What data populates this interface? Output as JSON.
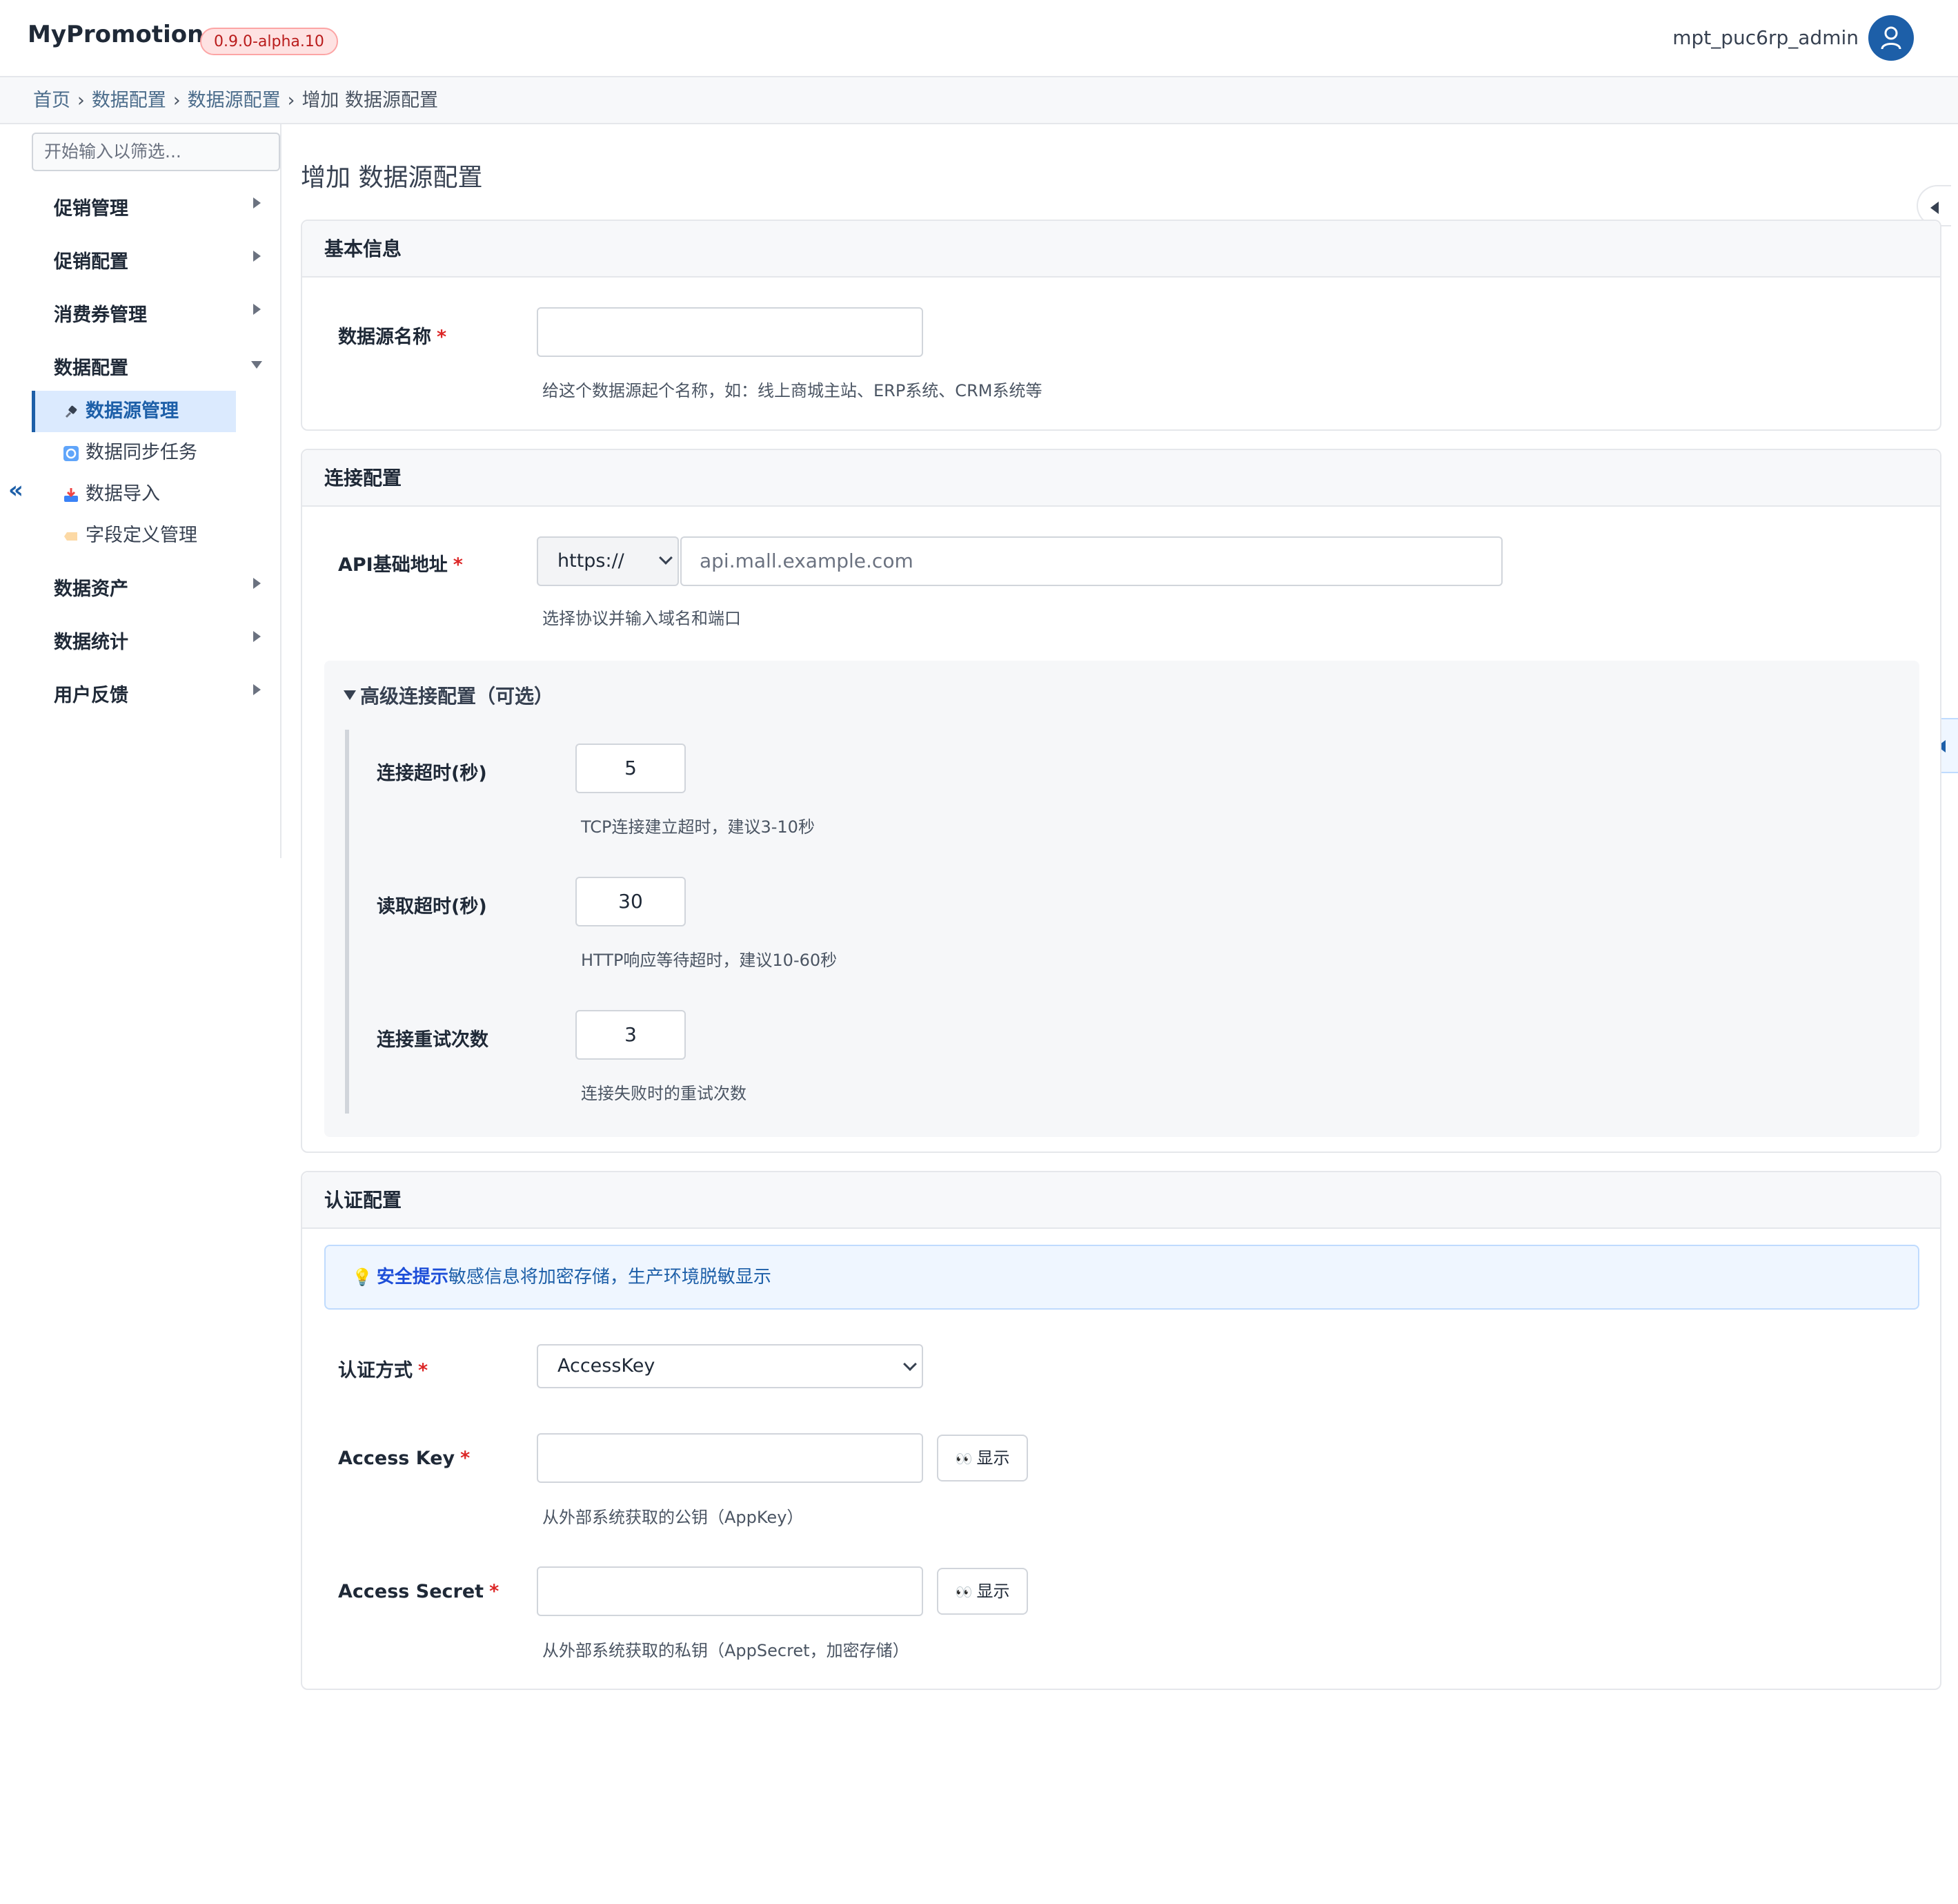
{
  "header": {
    "brand": "MyPromotion",
    "version": "0.9.0-alpha.10",
    "username": "mpt_puc6rp_admin",
    "avatar_icon": "user-icon"
  },
  "breadcrumb": {
    "items": [
      "首页",
      "数据配置",
      "数据源配置"
    ],
    "current": "增加 数据源配置",
    "separator": "›"
  },
  "sidebar": {
    "filter_placeholder": "开始输入以筛选...",
    "groups": [
      {
        "label": "促销管理",
        "expanded": false
      },
      {
        "label": "促销配置",
        "expanded": false
      },
      {
        "label": "消费券管理",
        "expanded": false
      },
      {
        "label": "数据配置",
        "expanded": true
      },
      {
        "label": "数据资产",
        "expanded": false
      },
      {
        "label": "数据统计",
        "expanded": false
      },
      {
        "label": "用户反馈",
        "expanded": false
      }
    ],
    "subitems": [
      {
        "label": "数据源管理",
        "icon": "plug-icon",
        "active": true
      },
      {
        "label": "数据同步任务",
        "icon": "sync-icon",
        "active": false
      },
      {
        "label": "数据导入",
        "icon": "inbox-tray-icon",
        "active": false
      },
      {
        "label": "字段定义管理",
        "icon": "label-tag-icon",
        "active": false
      }
    ],
    "collapse_label": "«"
  },
  "main": {
    "title": "增加 数据源配置",
    "basic": {
      "heading": "基本信息",
      "name_label": "数据源名称",
      "required_mark": "*",
      "name_value": "",
      "name_help": "给这个数据源起个名称，如：线上商城主站、ERP系统、CRM系统等"
    },
    "connection": {
      "heading": "连接配置",
      "api_label": "API基础地址",
      "protocol_value": "https://",
      "host_placeholder": "api.mall.example.com",
      "api_help": "选择协议并输入域名和端口",
      "advanced_title": "高级连接配置（可选）",
      "connect_timeout_label": "连接超时(秒)",
      "connect_timeout_value": "5",
      "connect_timeout_help": "TCP连接建立超时，建议3-10秒",
      "read_timeout_label": "读取超时(秒)",
      "read_timeout_value": "30",
      "read_timeout_help": "HTTP响应等待超时，建议10-60秒",
      "retries_label": "连接重试次数",
      "retries_value": "3",
      "retries_help": "连接失败时的重试次数"
    },
    "auth": {
      "heading": "认证配置",
      "alert_strong": "安全提示",
      "alert_text": "敏感信息将加密存储，生产环境脱敏显示",
      "method_label": "认证方式",
      "method_value": "AccessKey",
      "access_key_label": "Access Key",
      "access_key_value": "",
      "access_key_help": "从外部系统获取的公钥（AppKey）",
      "access_secret_label": "Access Secret",
      "access_secret_value": "",
      "access_secret_help": "从外部系统获取的私钥（AppSecret，加密存储）",
      "show_button": "显示",
      "show_icon": "eyes-icon"
    }
  },
  "colors": {
    "accent": "#1d5fa8",
    "required": "#dc2626",
    "badge_text": "#b91c1c",
    "badge_bg": "#fee2e2"
  }
}
